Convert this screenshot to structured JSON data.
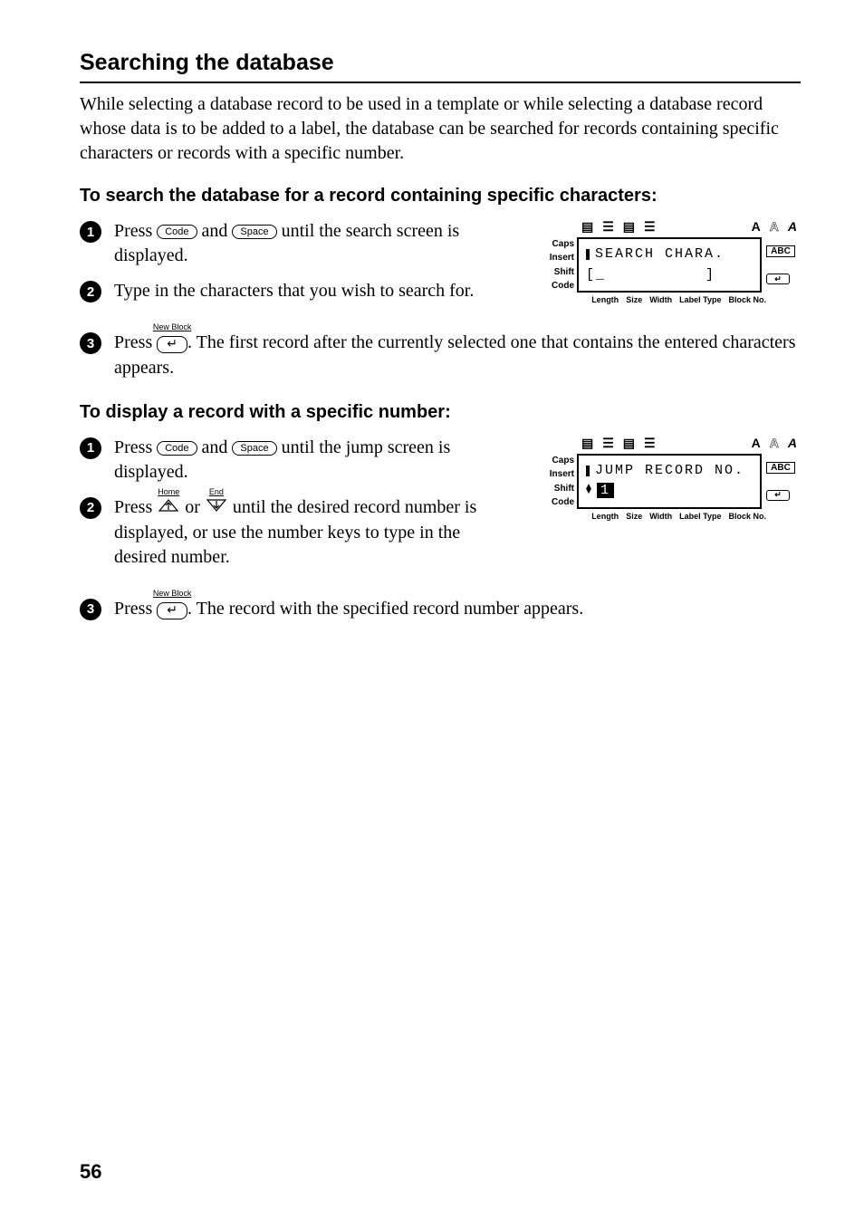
{
  "title": "Searching the database",
  "intro": "While selecting a database record to be used in a template or while selecting a database record whose data is to be added to a label, the database can be searched for records containing specific characters or records with a specific number.",
  "sectionA": {
    "heading": "To search the database for a record containing specific characters:",
    "step1_a": "Press ",
    "step1_b": " and ",
    "step1_c": " until the search screen is displayed.",
    "step2": "Type in the characters that you wish to search for.",
    "step3_a": "Press ",
    "step3_b": ". The first record after the currently selected one that contains the entered characters appears."
  },
  "sectionB": {
    "heading": "To display a record with a specific number:",
    "step1_a": "Press ",
    "step1_b": " and ",
    "step1_c": " until the jump screen is displayed.",
    "step2_a": "Press ",
    "step2_b": " or ",
    "step2_c": " until the desired record number is displayed, or use the number keys to type in the desired number.",
    "step3_a": "Press ",
    "step3_b": ". The record with the specified record number appears."
  },
  "keys": {
    "code": "Code",
    "space": "Space",
    "newblock": "New Block",
    "home": "Home",
    "end": "End"
  },
  "lcd": {
    "left": {
      "caps": "Caps",
      "insert": "Insert",
      "shift": "Shift",
      "code": "Code"
    },
    "right": {
      "abc": "ABC"
    },
    "bottom": {
      "length": "Length",
      "size": "Size",
      "width": "Width",
      "labeltype": "Label Type",
      "blockno": "Block No."
    },
    "top": {
      "a1": "A",
      "a2": "A",
      "a3": "A"
    },
    "screen1_line1": "SEARCH CHARA.",
    "screen1_line2_open": "[",
    "screen1_line2_close": "]",
    "screen2_line1": "JUMP RECORD NO.",
    "screen2_num": "1"
  },
  "pageNumber": "56"
}
